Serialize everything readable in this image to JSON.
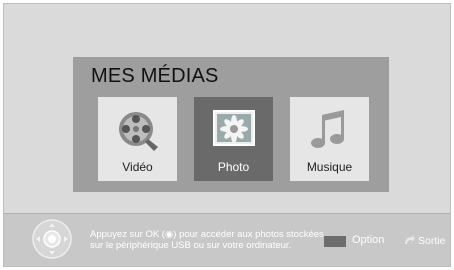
{
  "menu": {
    "title": "MES MÉDIAS",
    "items": [
      {
        "label": "Vidéo",
        "icon": "film-reel-icon",
        "selected": false
      },
      {
        "label": "Photo",
        "icon": "photo-flower-icon",
        "selected": true
      },
      {
        "label": "Musique",
        "icon": "music-note-icon",
        "selected": false
      }
    ]
  },
  "footer": {
    "hint_line1": "Appuyez sur OK (◉) pour accéder aux photos stockées",
    "hint_line2": "sur le périphérique USB ou sur votre ordinateur.",
    "option_label": "Option",
    "exit_label": "Sortie"
  }
}
